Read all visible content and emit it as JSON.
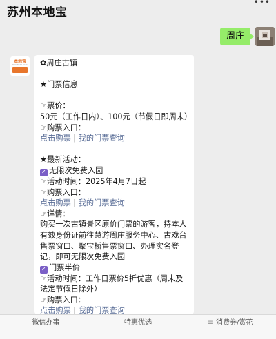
{
  "header": {
    "title": "苏州本地宝",
    "menu_dots": "•••"
  },
  "user_message": {
    "text": "周庄",
    "avatar_icon": "user-avatar-photo"
  },
  "bot_avatar": {
    "logo_text": "本地宝",
    "logo_sub": "bendibao.com"
  },
  "reply": {
    "lines": {
      "l1": "✿周庄古镇",
      "l2": "★门票信息",
      "l3": "☞票价：",
      "l4": "50元（工作日内）、100元（节假日即周末）",
      "l5": "☞购票入口：",
      "l6_link1": "点击购票",
      "l6_sep": " | ",
      "l6_link2": "我的门票查询",
      "l7": "★最新活动：",
      "l8": "无限次免费入园",
      "l9": "☞活动时间：2025年4月7日起",
      "l10": "☞购票入口：",
      "l11_link1": "点击购票",
      "l11_sep": " | ",
      "l11_link2": "我的门票查询",
      "l12": "☞详情：",
      "l13": "购买一次古镇景区原价门票的游客，持本人有效身份证前往慧游周庄服务中心、古戏台售票窗口、聚宝桥售票窗口、办理实名登记，即可无限次免费入园",
      "l14": "门票半价",
      "l15": "☞活动时间：工作日票价5折优惠（周末及法定节假日除外）",
      "l16": "☞购票入口：",
      "l17_link1": "点击购票",
      "l17_sep": " | ",
      "l17_link2": "我的门票查询"
    },
    "checkbox_glyph": "✓"
  },
  "bottom_menu": {
    "items": [
      "微信办事",
      "特惠优选",
      "消费券/赏花"
    ],
    "menu_icon_glyph": "≡"
  },
  "colors": {
    "out_bubble": "#95ec69",
    "link": "#576b95",
    "checkbox": "#7b5fc6",
    "brand": "#e8762c"
  }
}
